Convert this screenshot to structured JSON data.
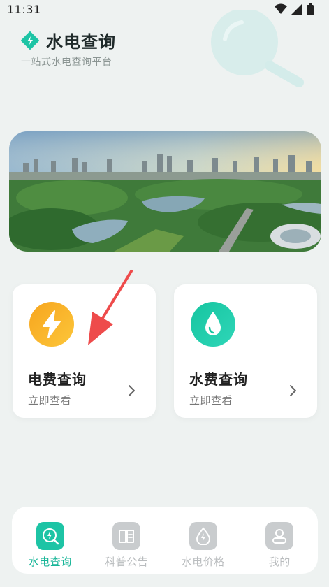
{
  "status_bar": {
    "time": "11:31"
  },
  "header": {
    "title": "水电查询",
    "subtitle": "一站式水电查询平台"
  },
  "cards": [
    {
      "title": "电费查询",
      "subtitle": "立即查看",
      "icon": "lightning-icon",
      "color": "#fbb427"
    },
    {
      "title": "水费查询",
      "subtitle": "立即查看",
      "icon": "water-drop-icon",
      "color": "#1bc8a8"
    }
  ],
  "bottom_nav": [
    {
      "label": "水电查询",
      "icon": "search-lightning-icon",
      "active": true
    },
    {
      "label": "科普公告",
      "icon": "book-icon",
      "active": false
    },
    {
      "label": "水电价格",
      "icon": "drop-lightning-icon",
      "active": false
    },
    {
      "label": "我的",
      "icon": "user-icon",
      "active": false
    }
  ],
  "colors": {
    "accent": "#1dc4a5",
    "background": "#eef2f1",
    "annotation": "#ee4b4b"
  }
}
